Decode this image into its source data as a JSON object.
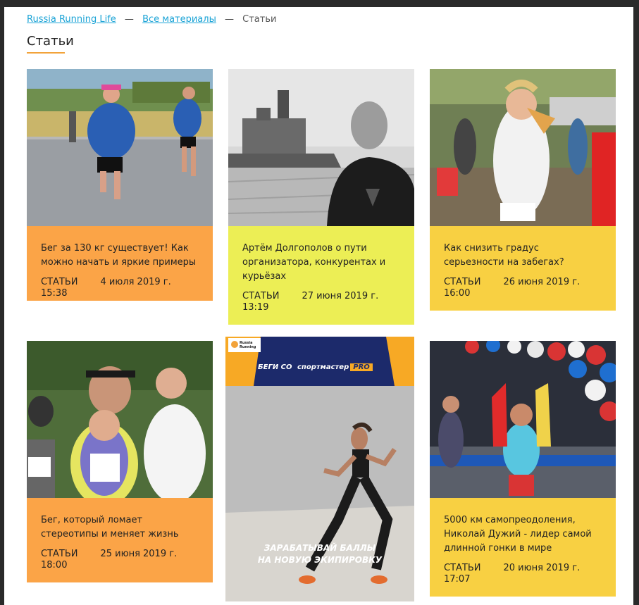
{
  "breadcrumb": {
    "home": "Russia Running Life",
    "all_materials": "Все материалы",
    "current": "Статьи",
    "separator": "—"
  },
  "page": {
    "title": "Статьи"
  },
  "articles": [
    {
      "title": "Бег за 130 кг существует! Как можно начать и яркие примеры",
      "category": "СТАТЬИ",
      "date": "4 июля 2019 г. 15:38",
      "color": "#fba447"
    },
    {
      "title": "Артём Долгополов о пути организатора, конкурентах и курьёзах",
      "category": "СТАТЬИ",
      "date": "27 июня 2019 г. 13:19",
      "color": "#ecee55"
    },
    {
      "title": "Как снизить градус серьезности на забегах?",
      "category": "СТАТЬИ",
      "date": "26 июня 2019 г. 16:00",
      "color": "#f8d042"
    },
    {
      "title": "Бег, который ломает стереотипы и меняет жизнь",
      "category": "СТАТЬИ",
      "date": "25 июня 2019 г. 18:00",
      "color": "#fba447"
    },
    {
      "title": "5000 км самопреодоления, Николай Дужий - лидер самой длинной гонки в мире",
      "category": "СТАТЬИ",
      "date": "20 июня 2019 г. 17:07",
      "color": "#f8d042"
    }
  ],
  "ad": {
    "logo_line1": "Russia",
    "logo_line2": "Running",
    "banner_prefix": "БЕГИ СО",
    "brand": "спортмастер",
    "brand_suffix": "PRO",
    "slogan_line1": "ЗАРАБАТЫВАЙ БАЛЛЫ",
    "slogan_line2": "НА НОВУЮ ЭКИПИРОВКУ"
  }
}
